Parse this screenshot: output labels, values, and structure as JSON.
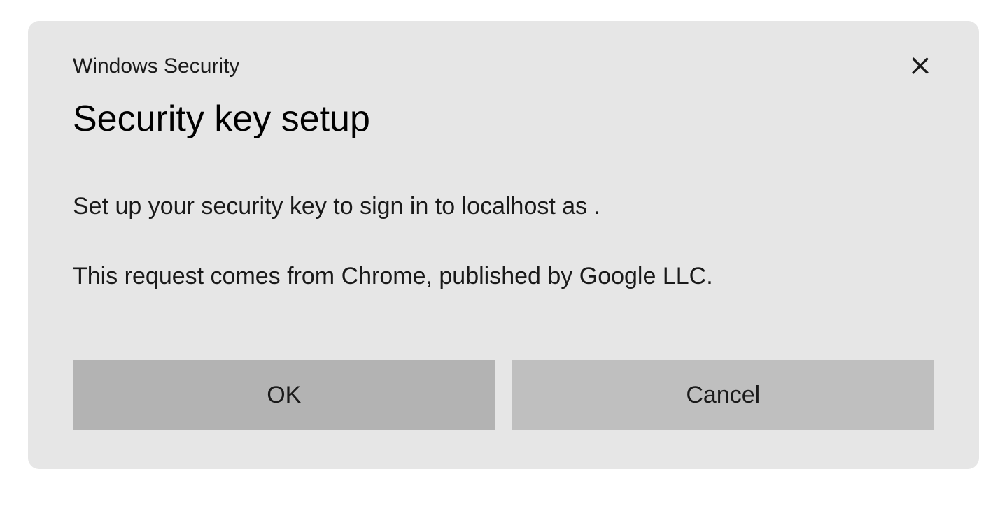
{
  "dialog": {
    "subtitle": "Windows Security",
    "title": "Security key setup",
    "body_line_1": "Set up your security key to sign in to localhost as .",
    "body_line_2": "This request comes from Chrome, published by Google LLC.",
    "buttons": {
      "ok": "OK",
      "cancel": "Cancel"
    }
  }
}
